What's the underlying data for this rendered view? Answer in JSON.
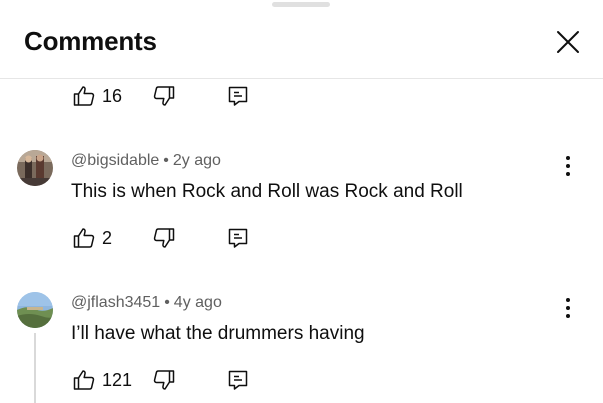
{
  "header": {
    "title": "Comments",
    "close_icon": "close-icon"
  },
  "top_actions": {
    "like_count": "16"
  },
  "comments": [
    {
      "author": "@bigsidable",
      "separator": "•",
      "time": "2y ago",
      "text": "This is when Rock and Roll was Rock and Roll",
      "like_count": "2"
    },
    {
      "author": "@jflash3451",
      "separator": "•",
      "time": "4y ago",
      "text": "I’ll have what the drummers having",
      "like_count": "121"
    }
  ],
  "icons": {
    "like": "thumbs-up-icon",
    "dislike": "thumbs-down-icon",
    "reply": "reply-icon",
    "more": "more-vert-icon"
  },
  "colors": {
    "text": "#0f0f0f",
    "meta": "#606060",
    "divider": "#e6e6e6"
  }
}
